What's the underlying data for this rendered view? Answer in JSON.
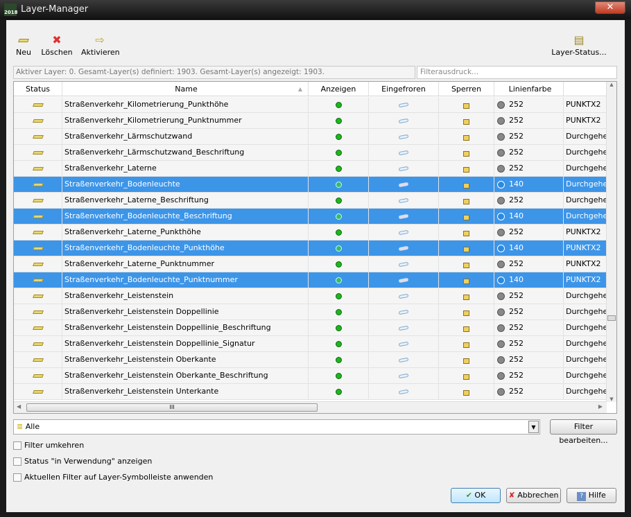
{
  "window": {
    "title": "Layer-Manager",
    "app_badge": "2018",
    "close": "✕"
  },
  "toolbar": {
    "new": "Neu",
    "delete": "Löschen",
    "activate": "Aktivieren",
    "layer_status": "Layer-Status..."
  },
  "info_text": "Aktiver Layer: 0. Gesamt-Layer(s) definiert: 1903. Gesamt-Layer(s) angezeigt: 1903.",
  "filter_placeholder": "Filterausdruck...",
  "columns": [
    "Status",
    "Name",
    "Anzeigen",
    "Eingefroren",
    "Sperren",
    "Linienfarbe",
    ""
  ],
  "rows": [
    {
      "name": "Straßenverkehr_Kilometrierung_Punkthöhe",
      "color": "252",
      "linetype": "PUNKTX2",
      "selected": false
    },
    {
      "name": "Straßenverkehr_Kilometrierung_Punktnummer",
      "color": "252",
      "linetype": "PUNKTX2",
      "selected": false
    },
    {
      "name": "Straßenverkehr_Lärmschutzwand",
      "color": "252",
      "linetype": "Durchgehe",
      "selected": false
    },
    {
      "name": "Straßenverkehr_Lärmschutzwand_Beschriftung",
      "color": "252",
      "linetype": "Durchgehe",
      "selected": false
    },
    {
      "name": "Straßenverkehr_Laterne",
      "color": "252",
      "linetype": "Durchgehe",
      "selected": false
    },
    {
      "name": "Straßenverkehr_Bodenleuchte",
      "color": "140",
      "linetype": "Durchgehe",
      "selected": true
    },
    {
      "name": "Straßenverkehr_Laterne_Beschriftung",
      "color": "252",
      "linetype": "Durchgehe",
      "selected": false
    },
    {
      "name": "Straßenverkehr_Bodenleuchte_Beschriftung",
      "color": "140",
      "linetype": "Durchgehe",
      "selected": true
    },
    {
      "name": "Straßenverkehr_Laterne_Punkthöhe",
      "color": "252",
      "linetype": "PUNKTX2",
      "selected": false
    },
    {
      "name": "Straßenverkehr_Bodenleuchte_Punkthöhe",
      "color": "140",
      "linetype": "PUNKTX2",
      "selected": true
    },
    {
      "name": "Straßenverkehr_Laterne_Punktnummer",
      "color": "252",
      "linetype": "PUNKTX2",
      "selected": false
    },
    {
      "name": "Straßenverkehr_Bodenleuchte_Punktnummer",
      "color": "140",
      "linetype": "PUNKTX2",
      "selected": true
    },
    {
      "name": "Straßenverkehr_Leistenstein",
      "color": "252",
      "linetype": "Durchgehe",
      "selected": false
    },
    {
      "name": "Straßenverkehr_Leistenstein Doppellinie",
      "color": "252",
      "linetype": "Durchgehe",
      "selected": false
    },
    {
      "name": "Straßenverkehr_Leistenstein Doppellinie_Beschriftung",
      "color": "252",
      "linetype": "Durchgehe",
      "selected": false
    },
    {
      "name": "Straßenverkehr_Leistenstein Doppellinie_Signatur",
      "color": "252",
      "linetype": "Durchgehe",
      "selected": false
    },
    {
      "name": "Straßenverkehr_Leistenstein Oberkante",
      "color": "252",
      "linetype": "Durchgehe",
      "selected": false
    },
    {
      "name": "Straßenverkehr_Leistenstein Oberkante_Beschriftung",
      "color": "252",
      "linetype": "Durchgehe",
      "selected": false
    },
    {
      "name": "Straßenverkehr_Leistenstein Unterkante",
      "color": "252",
      "linetype": "Durchgehe",
      "selected": false
    }
  ],
  "hscroll_grip": "III",
  "filter_combo": {
    "value": "Alle",
    "edit": "Filter bearbeiten..."
  },
  "checkboxes": [
    {
      "label": "Filter umkehren",
      "checked": false
    },
    {
      "label": "Status \"in Verwendung\" anzeigen",
      "checked": false
    },
    {
      "label": "Aktuellen Filter auf Layer-Symbolleiste anwenden",
      "checked": false
    }
  ],
  "buttons": {
    "ok": "OK",
    "cancel": "Abbrechen",
    "help": "Hilfe"
  },
  "colors": {
    "selection": "#3d95e8",
    "visible_on": "#1fb51f",
    "color_252": "#888888",
    "color_140": "#2a8ae0"
  }
}
